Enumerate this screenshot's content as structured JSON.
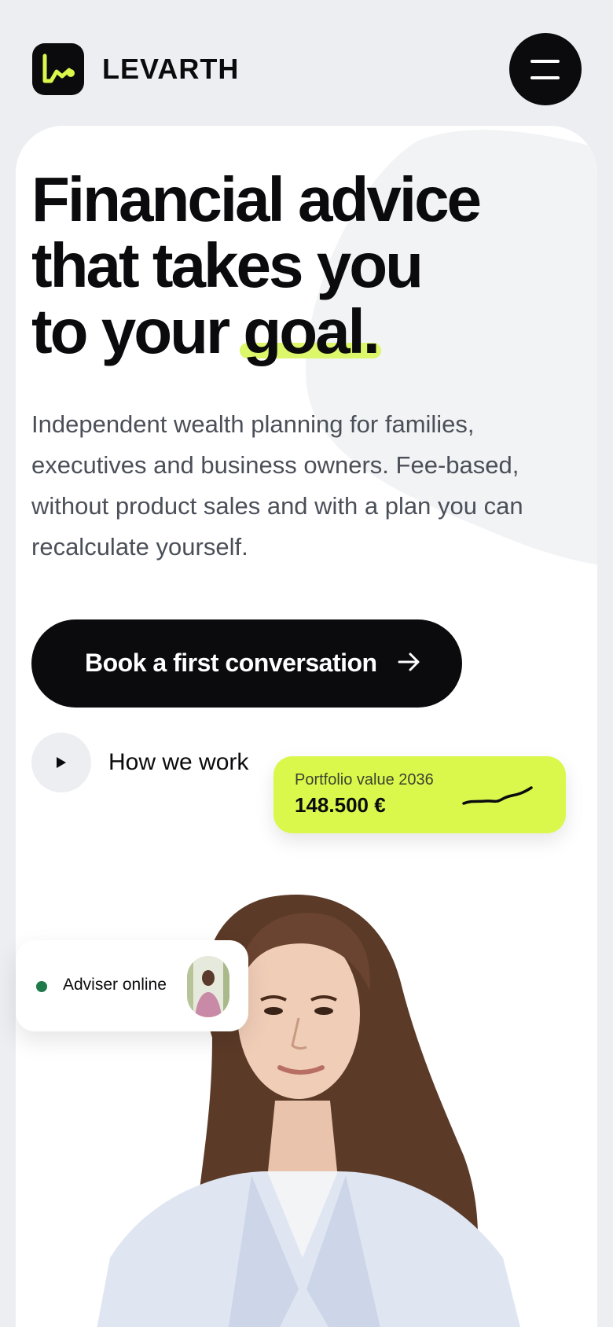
{
  "header": {
    "brand": "LEVARTH",
    "logo_icon": "chart-line-icon",
    "menu_icon": "hamburger-menu-icon"
  },
  "hero": {
    "headline_line1": "Financial advice",
    "headline_line2": "that takes you",
    "headline_line3_prefix": "to your ",
    "headline_highlight": "goal.",
    "intro": "Independent wealth planning for families, executives and business owners. Fee-based, without product sales and with a plan you can recalculate yourself.",
    "cta_label": "Book a first conversation",
    "cta_icon": "arrow-right-icon",
    "secondary_label": "How we work",
    "secondary_icon": "play-icon"
  },
  "portfolio_card": {
    "label": "Portfolio value 2036",
    "value": "148.500 €",
    "icon": "sparkline-icon"
  },
  "adviser_card": {
    "label": "Adviser online",
    "status_color": "#1f7a4a"
  },
  "colors": {
    "accent": "#d9f84b",
    "dark": "#0b0b0d",
    "background": "#eceef1"
  }
}
